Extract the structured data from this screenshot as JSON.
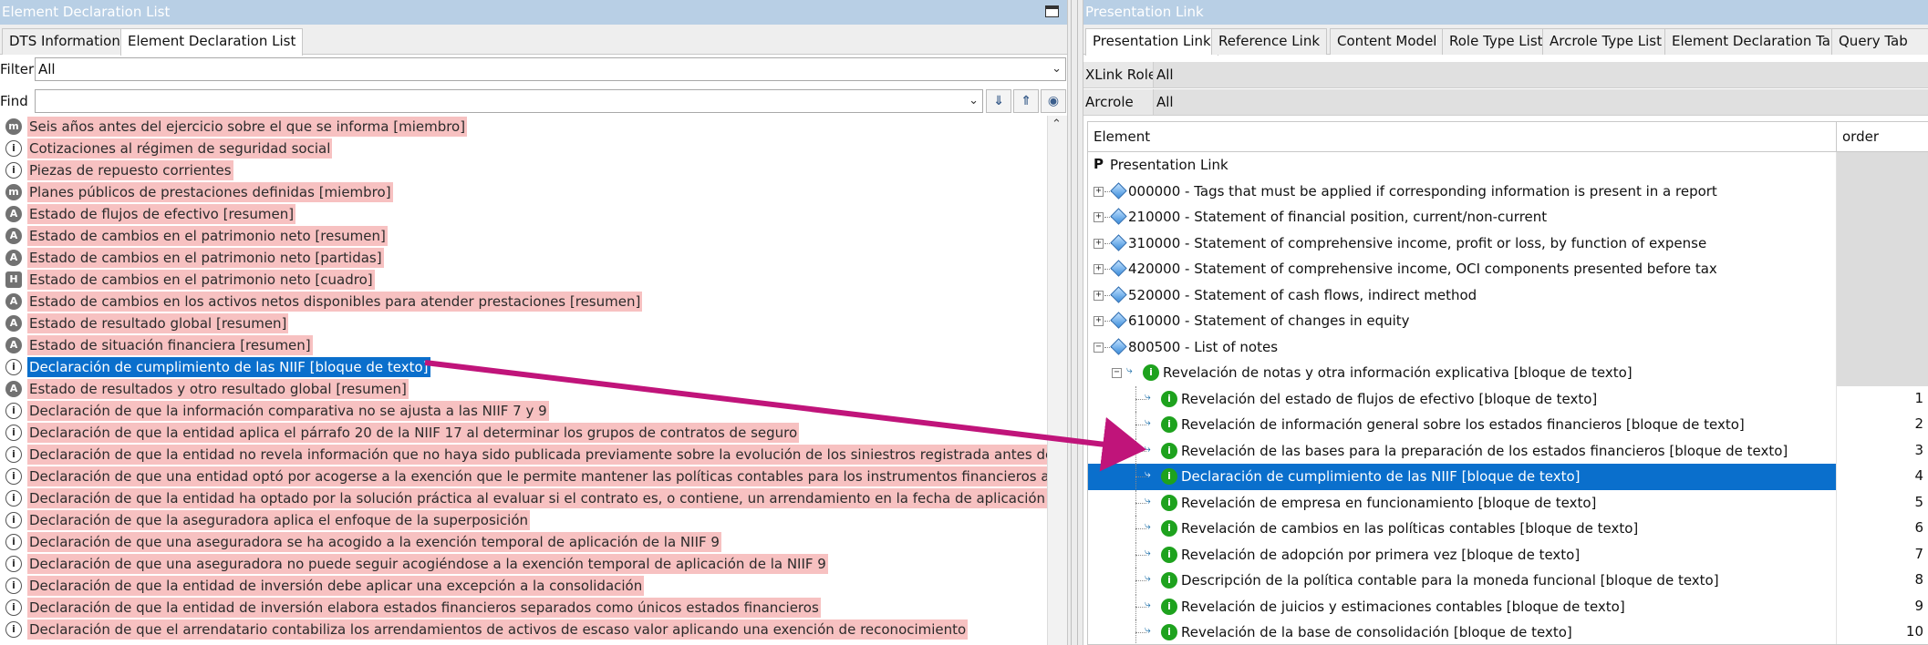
{
  "left": {
    "title": "Element Declaration List",
    "tabs": [
      "DTS Information",
      "Element Declaration List"
    ],
    "filter": {
      "label": "Filter",
      "value": "All"
    },
    "find": {
      "label": "Find",
      "value": ""
    },
    "rows": [
      {
        "icon": "m",
        "text": "Seis años antes del ejercicio sobre el que se informa [miembro]"
      },
      {
        "icon": "i",
        "text": "Cotizaciones al régimen de seguridad social"
      },
      {
        "icon": "i",
        "text": "Piezas de repuesto corrientes"
      },
      {
        "icon": "m",
        "text": "Planes públicos de prestaciones definidas [miembro]"
      },
      {
        "icon": "a",
        "text": "Estado de flujos de efectivo [resumen]"
      },
      {
        "icon": "a",
        "text": "Estado de cambios en el patrimonio neto [resumen]"
      },
      {
        "icon": "a",
        "text": "Estado de cambios en el patrimonio neto [partidas]"
      },
      {
        "icon": "h",
        "text": "Estado de cambios en el patrimonio neto [cuadro]"
      },
      {
        "icon": "a",
        "text": "Estado de cambios en los activos netos disponibles para atender prestaciones [resumen]"
      },
      {
        "icon": "a",
        "text": "Estado de resultado global [resumen]"
      },
      {
        "icon": "a",
        "text": "Estado de situación financiera [resumen]"
      },
      {
        "icon": "i",
        "text": "Declaración de cumplimiento de las NIIF [bloque de texto]",
        "selected": true
      },
      {
        "icon": "a",
        "text": "Estado de resultados y otro resultado global [resumen]"
      },
      {
        "icon": "i",
        "text": "Declaración de que la información comparativa no se ajusta a las NIIF 7 y 9"
      },
      {
        "icon": "i",
        "text": "Declaración de que la entidad aplica el párrafo 20 de la NIIF 17 al determinar los grupos de contratos de seguro"
      },
      {
        "icon": "i",
        "text": "Declaración de que la entidad no revela información que no haya sido publicada previamente sobre la evolución de los siniestros registrada antes de los cin"
      },
      {
        "icon": "i",
        "text": "Declaración de que una entidad optó por acogerse a la exención que le permite mantener las políticas contables para los instrumentos financieros aplicadas"
      },
      {
        "icon": "i",
        "text": "Declaración de que la entidad ha optado por la solución práctica al evaluar si el contrato es, o contiene, un arrendamiento en la fecha de aplicación inicial d"
      },
      {
        "icon": "i",
        "text": "Declaración de que la aseguradora aplica el enfoque de la superposición"
      },
      {
        "icon": "i",
        "text": "Declaración de que una aseguradora se ha acogido a la exención temporal de aplicación de la NIIF 9"
      },
      {
        "icon": "i",
        "text": "Declaración de que una aseguradora no puede seguir acogiéndose a la exención temporal de aplicación de la NIIF 9"
      },
      {
        "icon": "i",
        "text": "Declaración de que la entidad de inversión debe aplicar una excepción a la consolidación"
      },
      {
        "icon": "i",
        "text": "Declaración de que la entidad de inversión elabora estados financieros separados como únicos estados financieros"
      },
      {
        "icon": "i",
        "text": "Declaración de que el arrendatario contabiliza los arrendamientos de activos de escaso valor aplicando una exención de reconocimiento"
      }
    ]
  },
  "right": {
    "title": "Presentation Link",
    "tabs": [
      "Presentation Link",
      "Reference Link",
      "Content Model",
      "Role Type List",
      "Arcrole Type List",
      "Element Declaration Table",
      "Query Tab"
    ],
    "xlink_role": {
      "label": "XLink Role",
      "value": "All"
    },
    "arcrole": {
      "label": "Arcrole",
      "value": "All"
    },
    "columns": {
      "element": "Element",
      "order": "order"
    },
    "root": "Presentation Link",
    "groups": [
      "000000 - Tags that must be applied if corresponding information is present in a report",
      "210000 - Statement of financial position, current/non-current",
      "310000 - Statement of comprehensive income, profit or loss, by function of expense",
      "420000 - Statement of comprehensive income, OCI components presented before tax",
      "520000 - Statement of cash flows, indirect method",
      "610000 - Statement of changes in equity",
      "800500 - List of notes"
    ],
    "parent": "Revelación de notas y otra información explicativa [bloque de texto]",
    "children": [
      {
        "label": "Revelación del estado de flujos de efectivo [bloque de texto]",
        "order": "1"
      },
      {
        "label": "Revelación de información general sobre los estados financieros [bloque de texto]",
        "order": "2"
      },
      {
        "label": "Revelación de las bases para la preparación de los estados financieros [bloque de texto]",
        "order": "3"
      },
      {
        "label": "Declaración de cumplimiento de las NIIF [bloque de texto]",
        "order": "4",
        "selected": true
      },
      {
        "label": "Revelación de empresa en funcionamiento [bloque de texto]",
        "order": "5"
      },
      {
        "label": "Revelación de cambios en las políticas contables [bloque de texto]",
        "order": "6"
      },
      {
        "label": "Revelación de adopción por primera vez [bloque de texto]",
        "order": "7"
      },
      {
        "label": "Descripción de la política contable para la moneda funcional [bloque de texto]",
        "order": "8"
      },
      {
        "label": "Revelación de juicios y estimaciones contables [bloque de texto]",
        "order": "9"
      },
      {
        "label": "Revelación de la base de consolidación [bloque de texto]",
        "order": "10"
      }
    ]
  },
  "colors": {
    "highlight": "#f7c1c1",
    "selection": "#0a6fcc",
    "arrow": "#c0147a",
    "titlebar": "#b8cfe5"
  }
}
